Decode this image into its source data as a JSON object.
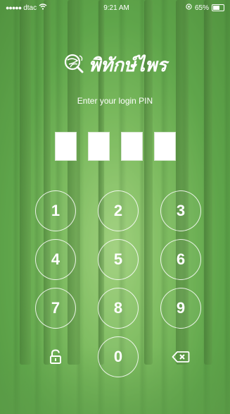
{
  "status": {
    "carrier": "dtac",
    "time": "9:21 AM",
    "battery": "65%"
  },
  "app": {
    "brand_name": "พิทักษ์ไพร",
    "subtitle": "Enter your login PIN"
  },
  "pin": {
    "digits": [
      "",
      "",
      "",
      ""
    ]
  },
  "keypad": {
    "k1": "1",
    "k2": "2",
    "k3": "3",
    "k4": "4",
    "k5": "5",
    "k6": "6",
    "k7": "7",
    "k8": "8",
    "k9": "9",
    "k0": "0",
    "left_icon": "unlock-icon",
    "right_icon": "backspace-icon"
  }
}
